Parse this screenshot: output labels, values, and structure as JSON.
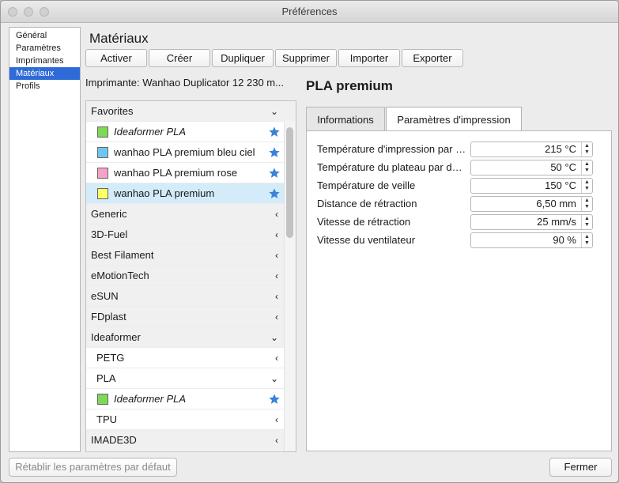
{
  "window": {
    "title": "Préférences"
  },
  "sidebar": {
    "items": [
      {
        "label": "Général"
      },
      {
        "label": "Paramètres"
      },
      {
        "label": "Imprimantes"
      },
      {
        "label": "Matériaux"
      },
      {
        "label": "Profils"
      }
    ],
    "selected": "Matériaux"
  },
  "section_title": "Matériaux",
  "toolbar": {
    "activate": "Activer",
    "create": "Créer",
    "duplicate": "Dupliquer",
    "delete": "Supprimer",
    "import": "Importer",
    "export": "Exporter"
  },
  "printer_label": "Imprimante: Wanhao Duplicator 12 230 m...",
  "material_list": {
    "favorites": "Favorites",
    "fav_items": [
      {
        "label": "Ideaformer PLA",
        "color": "#7ed957",
        "italic": true
      },
      {
        "label": "wanhao PLA premium bleu ciel",
        "color": "#6ec6f0"
      },
      {
        "label": "wanhao PLA premium rose",
        "color": "#f7a0c8"
      },
      {
        "label": "wanhao PLA premium",
        "color": "#ffff66",
        "selected": true
      }
    ],
    "brands": [
      "Generic",
      "3D-Fuel",
      "Best Filament",
      "eMotionTech",
      "eSUN",
      "FDplast"
    ],
    "expanded_brand": "Ideaformer",
    "types": [
      "PETG",
      "PLA"
    ],
    "pla_item": {
      "label": "Ideaformer PLA",
      "color": "#7ed957"
    },
    "tpu": "TPU",
    "last_brand": "IMADE3D"
  },
  "material": {
    "title": "PLA premium",
    "tabs": [
      "Informations",
      "Paramètres d'impression"
    ],
    "active_tab": "Paramètres d'impression",
    "properties": [
      {
        "label": "Température d'impression par défaut",
        "value": "215 °C"
      },
      {
        "label": "Température du plateau par défaut",
        "value": "50 °C"
      },
      {
        "label": "Température de veille",
        "value": "150 °C"
      },
      {
        "label": "Distance de rétraction",
        "value": "6,50 mm"
      },
      {
        "label": "Vitesse de rétraction",
        "value": "25 mm/s"
      },
      {
        "label": "Vitesse du ventilateur",
        "value": "90 %"
      }
    ]
  },
  "footer": {
    "reset": "Rétablir les paramètres par défaut",
    "close": "Fermer"
  },
  "colors": {
    "accent": "#2f6bd8",
    "selection": "#d4ebf9",
    "star": "#3b82d8"
  }
}
